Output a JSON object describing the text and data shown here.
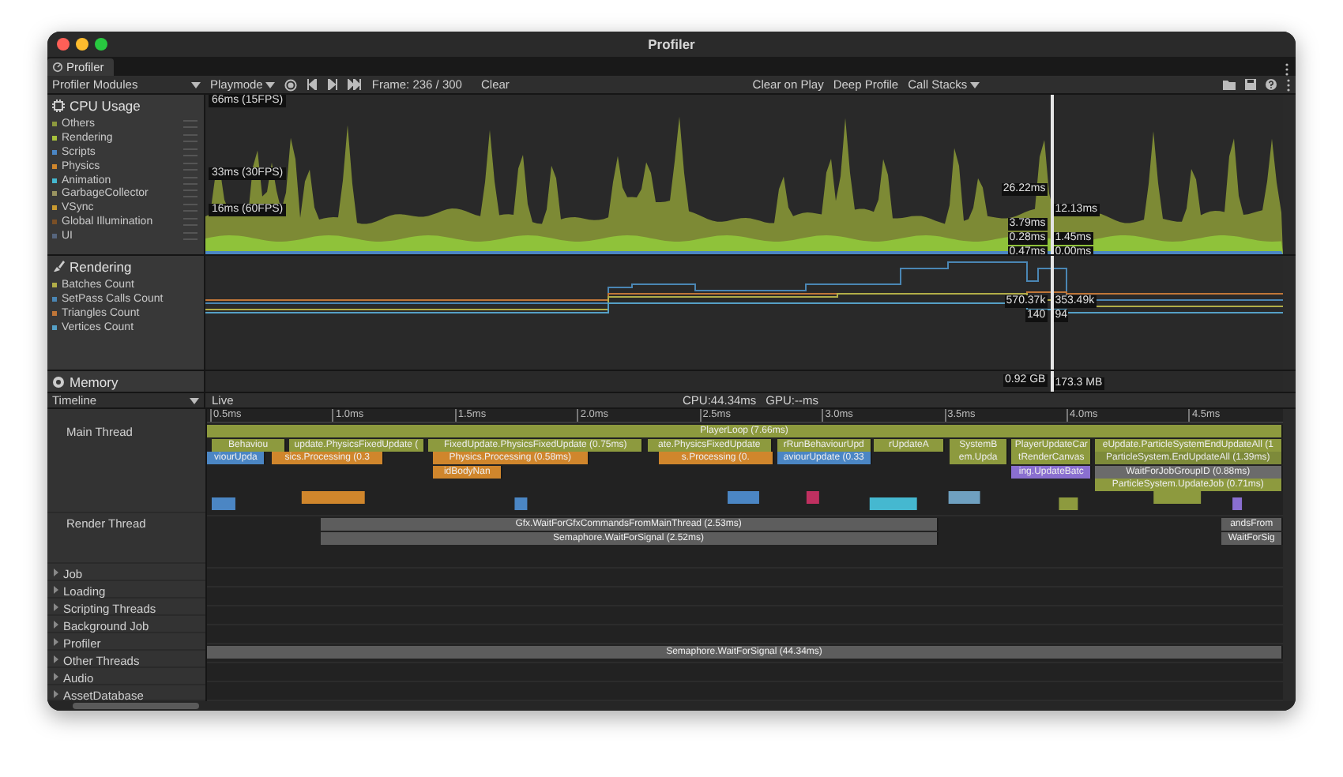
{
  "window": {
    "title": "Profiler"
  },
  "tab": {
    "label": "Profiler"
  },
  "toolbar": {
    "modules": "Profiler Modules",
    "target": "Playmode",
    "frame": "Frame: 236 / 300",
    "clear": "Clear",
    "clear_on_play": "Clear on Play",
    "deep_profile": "Deep Profile",
    "call_stacks": "Call Stacks"
  },
  "cpu_module": {
    "title": "CPU Usage",
    "legend": [
      {
        "name": "Others",
        "color": "#8d9a3e"
      },
      {
        "name": "Rendering",
        "color": "#a8c23c"
      },
      {
        "name": "Scripts",
        "color": "#4b86c4"
      },
      {
        "name": "Physics",
        "color": "#d0862c"
      },
      {
        "name": "Animation",
        "color": "#45b8d0"
      },
      {
        "name": "GarbageCollector",
        "color": "#9a9460"
      },
      {
        "name": "VSync",
        "color": "#c99a30"
      },
      {
        "name": "Global Illumination",
        "color": "#7a4f26"
      },
      {
        "name": "UI",
        "color": "#56657d"
      }
    ],
    "thresholds": [
      "66ms (15FPS)",
      "33ms (30FPS)",
      "16ms (60FPS)"
    ],
    "readouts": [
      "26.22ms",
      "12.13ms",
      "3.79ms",
      "0.28ms",
      "1.45ms",
      "0.47ms",
      "0.00ms"
    ]
  },
  "rendering_module": {
    "title": "Rendering",
    "legend": [
      {
        "name": "Batches Count",
        "color": "#b2ae48"
      },
      {
        "name": "SetPass Calls Count",
        "color": "#4a86b4"
      },
      {
        "name": "Triangles Count",
        "color": "#c07638"
      },
      {
        "name": "Vertices Count",
        "color": "#55a0c6"
      }
    ],
    "readouts": [
      "570.37k",
      "353.49k",
      "140",
      "94"
    ]
  },
  "memory_module": {
    "title": "Memory",
    "readouts": [
      "0.92 GB",
      "173.3 MB"
    ]
  },
  "timeline": {
    "view": "Timeline",
    "mode": "Live",
    "cpu": "CPU:44.34ms",
    "gpu": "GPU:--ms",
    "ticks": [
      "0.5ms",
      "1.0ms",
      "1.5ms",
      "2.0ms",
      "2.5ms",
      "3.0ms",
      "3.5ms",
      "4.0ms",
      "4.5ms"
    ],
    "threads": [
      {
        "name": "Main Thread",
        "kind": "flame",
        "bars": [
          {
            "label": "PlayerLoop (7.66ms)",
            "color": "#8d9a3e"
          },
          {
            "label": "Behaviou",
            "color": "#8d9a3e"
          },
          {
            "label": "update.PhysicsFixedUpdate (",
            "color": "#8d9a3e"
          },
          {
            "label": "FixedUpdate.PhysicsFixedUpdate (0.75ms)",
            "color": "#8d9a3e"
          },
          {
            "label": "ate.PhysicsFixedUpdate",
            "color": "#8d9a3e"
          },
          {
            "label": "rRunBehaviourUpd",
            "color": "#8d9a3e"
          },
          {
            "label": "rUpdateA",
            "color": "#8d9a3e"
          },
          {
            "label": "SystemB",
            "color": "#8d9a3e"
          },
          {
            "label": "PlayerUpdateCar",
            "color": "#8d9a3e"
          },
          {
            "label": "eUpdate.ParticleSystemEndUpdateAll (1",
            "color": "#8d9a3e"
          },
          {
            "label": "viourUpda",
            "color": "#4b86c4"
          },
          {
            "label": "sics.Processing (0.3",
            "color": "#d0862c"
          },
          {
            "label": "Physics.Processing (0.58ms)",
            "color": "#d0862c"
          },
          {
            "label": "s.Processing (0.",
            "color": "#d0862c"
          },
          {
            "label": "aviourUpdate (0.33",
            "color": "#4b86c4"
          },
          {
            "label": "em.Upda",
            "color": "#8d9a3e"
          },
          {
            "label": "tRenderCanvas",
            "color": "#8d9a3e"
          },
          {
            "label": "ParticleSystem.EndUpdateAll (1.39ms)",
            "color": "#7d8a3a"
          },
          {
            "label": "idBodyNan",
            "color": "#d0862c"
          },
          {
            "label": "ing.UpdateBatc",
            "color": "#8a6fd0"
          },
          {
            "label": "WaitForJobGroupID (0.88ms)",
            "color": "#6b6b6b"
          },
          {
            "label": "ParticleSystem.UpdateJob (0.71ms)",
            "color": "#8d9a3e"
          }
        ]
      },
      {
        "name": "Render Thread",
        "kind": "flame",
        "bars": [
          {
            "label": "Gfx.WaitForGfxCommandsFromMainThread (2.53ms)",
            "color": "#5d5d5d"
          },
          {
            "label": "Semaphore.WaitForSignal (2.52ms)",
            "color": "#5d5d5d"
          },
          {
            "label": "andsFrom",
            "color": "#5d5d5d"
          },
          {
            "label": "WaitForSig",
            "color": "#5d5d5d"
          }
        ]
      },
      {
        "name": "Job",
        "kind": "group",
        "expanded": false
      },
      {
        "name": "Loading",
        "kind": "group",
        "expanded": false
      },
      {
        "name": "Scripting Threads",
        "kind": "group",
        "expanded": false
      },
      {
        "name": "Background Job",
        "kind": "group",
        "expanded": false
      },
      {
        "name": "Profiler",
        "kind": "group",
        "expanded": false,
        "bars": [
          {
            "label": "Semaphore.WaitForSignal (44.34ms)",
            "color": "#5d5d5d"
          }
        ]
      },
      {
        "name": "Other Threads",
        "kind": "group",
        "expanded": false
      },
      {
        "name": "Audio",
        "kind": "group",
        "expanded": false
      },
      {
        "name": "AssetDatabase",
        "kind": "group",
        "expanded": false
      }
    ]
  }
}
